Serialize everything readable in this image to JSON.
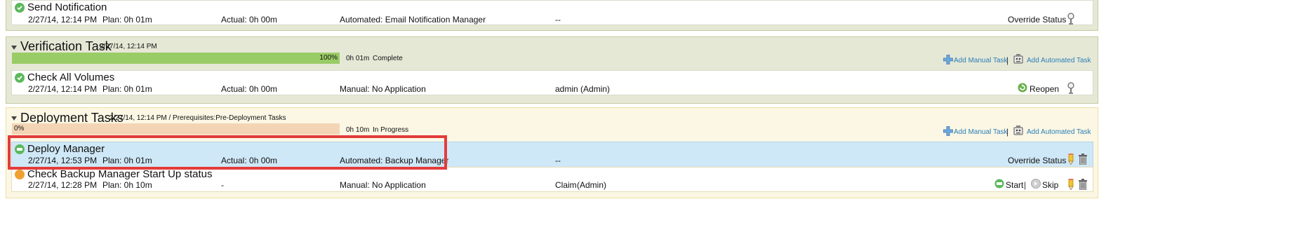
{
  "rows": {
    "send_notification": {
      "name": "Send Notification",
      "date": "2/27/14, 12:14 PM",
      "plan": "Plan: 0h 01m",
      "actual": "Actual: 0h 00m",
      "type": "Automated: Email Notification Manager",
      "owner": "--",
      "action": "Override Status"
    },
    "check_all_volumes": {
      "name": "Check All Volumes",
      "date": "2/27/14, 12:14 PM",
      "plan": "Plan: 0h 01m",
      "actual": "Actual: 0h 00m",
      "type": "Manual: No Application",
      "owner": "admin (Admin)",
      "action": "Reopen"
    },
    "deploy_manager": {
      "name": "Deploy Manager",
      "date": "2/27/14, 12:53 PM",
      "plan": "Plan: 0h 01m",
      "actual": "Actual: 0h 00m",
      "type": "Automated: Backup Manager",
      "owner": "--",
      "action": "Override Status"
    },
    "check_backup": {
      "name": "Check Backup Manager Start Up status",
      "date": "2/27/14, 12:28 PM",
      "plan": "Plan: 0h 10m",
      "actual": "-",
      "type": "Manual: No Application",
      "owner_link": "Claim",
      "owner_rest": "(Admin)",
      "start": "Start",
      "skip": "Skip"
    }
  },
  "sections": {
    "verification": {
      "title": "Verification Task",
      "date": "2/27/14, 12:14 PM",
      "progress_label": "100%",
      "progress": 1.0,
      "time": "0h 01m",
      "status": "Complete",
      "add_manual": "Add Manual Task",
      "add_automated": "Add Automated Task",
      "divider": "|"
    },
    "deployment": {
      "title": "Deployment Tasks",
      "date": "2/27/14, 12:14 PM / Prerequisites:Pre-Deployment Tasks",
      "progress_label": "0%",
      "progress": 0.0,
      "time": "0h 10m",
      "status": "In Progress",
      "add_manual": "Add Manual Task",
      "add_automated": "Add Automated Task",
      "divider": "|"
    }
  },
  "colors": {
    "section_complete_bg": "#e6e8d6",
    "section_complete_border": "#c6cba0",
    "section_progress_bg": "#fbf7e4",
    "section_progress_border": "#eedfa4",
    "progress_fill": "#99cc66",
    "progress_empty": "#f3d5b5",
    "row_selected": "#cfe8f7",
    "highlight_box": "#e33b3b",
    "link": "#2a7fb8"
  },
  "icons": [
    "check-circle-icon",
    "pin-icon",
    "plus-icon",
    "robot-icon",
    "reopen-icon",
    "start-icon",
    "skip-icon",
    "edit-icon",
    "trash-icon",
    "collapse-arrow-icon",
    "warning-icon"
  ]
}
